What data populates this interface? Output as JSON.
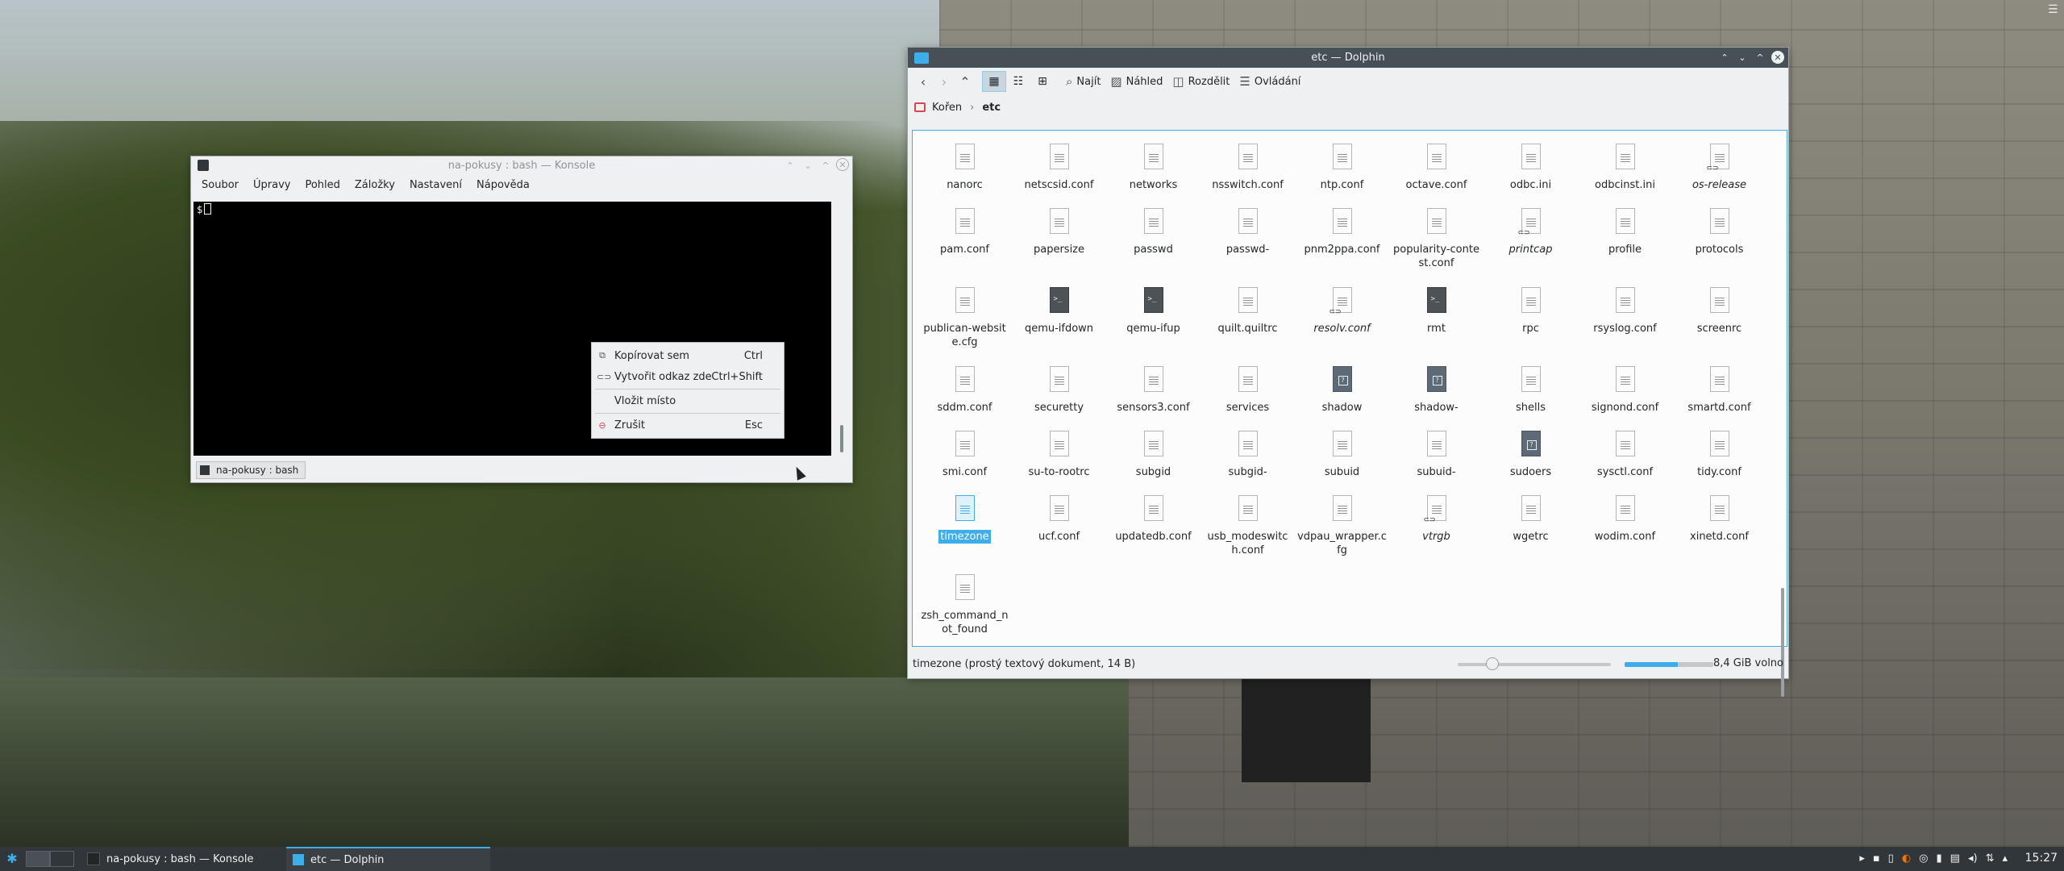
{
  "konsole": {
    "title": "na-pokusy : bash — Konsole",
    "menu": [
      "Soubor",
      "Úpravy",
      "Pohled",
      "Záložky",
      "Nastavení",
      "Nápověda"
    ],
    "prompt": "$",
    "tab_label": "na-pokusy : bash"
  },
  "context_menu": {
    "items": [
      {
        "label": "Kopírovat sem",
        "shortcut": "Ctrl",
        "icon": "copy-icon"
      },
      {
        "label": "Vytvořit odkaz zde",
        "shortcut": "Ctrl+Shift",
        "icon": "link-icon"
      },
      {
        "label": "Vložit místo",
        "shortcut": "",
        "icon": ""
      },
      {
        "label": "Zrušit",
        "shortcut": "Esc",
        "icon": "cancel-icon"
      }
    ]
  },
  "dolphin": {
    "title": "etc — Dolphin",
    "toolbar": {
      "find": "Najít",
      "preview": "Náhled",
      "split": "Rozdělit",
      "control": "Ovládání"
    },
    "breadcrumb": {
      "root": "Kořen",
      "current": "etc"
    },
    "files": [
      {
        "name": "nanorc",
        "type": "text"
      },
      {
        "name": "netscsid.conf",
        "type": "text"
      },
      {
        "name": "networks",
        "type": "text"
      },
      {
        "name": "nsswitch.conf",
        "type": "text"
      },
      {
        "name": "ntp.conf",
        "type": "text"
      },
      {
        "name": "octave.conf",
        "type": "text"
      },
      {
        "name": "odbc.ini",
        "type": "text"
      },
      {
        "name": "odbcinst.ini",
        "type": "text"
      },
      {
        "name": "os-release",
        "type": "link"
      },
      {
        "name": "pam.conf",
        "type": "text"
      },
      {
        "name": "papersize",
        "type": "text"
      },
      {
        "name": "passwd",
        "type": "text"
      },
      {
        "name": "passwd-",
        "type": "text"
      },
      {
        "name": "pnm2ppa.conf",
        "type": "text"
      },
      {
        "name": "popularity-contest.conf",
        "type": "text"
      },
      {
        "name": "printcap",
        "type": "link"
      },
      {
        "name": "profile",
        "type": "text"
      },
      {
        "name": "protocols",
        "type": "text"
      },
      {
        "name": "publican-website.cfg",
        "type": "text"
      },
      {
        "name": "qemu-ifdown",
        "type": "script"
      },
      {
        "name": "qemu-ifup",
        "type": "script"
      },
      {
        "name": "quilt.quiltrc",
        "type": "text"
      },
      {
        "name": "resolv.conf",
        "type": "link"
      },
      {
        "name": "rmt",
        "type": "script"
      },
      {
        "name": "rpc",
        "type": "text"
      },
      {
        "name": "rsyslog.conf",
        "type": "text"
      },
      {
        "name": "screenrc",
        "type": "text"
      },
      {
        "name": "sddm.conf",
        "type": "text"
      },
      {
        "name": "securetty",
        "type": "text"
      },
      {
        "name": "sensors3.conf",
        "type": "text"
      },
      {
        "name": "services",
        "type": "text"
      },
      {
        "name": "shadow",
        "type": "locked"
      },
      {
        "name": "shadow-",
        "type": "locked"
      },
      {
        "name": "shells",
        "type": "text"
      },
      {
        "name": "signond.conf",
        "type": "text"
      },
      {
        "name": "smartd.conf",
        "type": "text"
      },
      {
        "name": "smi.conf",
        "type": "text"
      },
      {
        "name": "su-to-rootrc",
        "type": "text"
      },
      {
        "name": "subgid",
        "type": "text"
      },
      {
        "name": "subgid-",
        "type": "text"
      },
      {
        "name": "subuid",
        "type": "text"
      },
      {
        "name": "subuid-",
        "type": "text"
      },
      {
        "name": "sudoers",
        "type": "locked"
      },
      {
        "name": "sysctl.conf",
        "type": "text"
      },
      {
        "name": "tidy.conf",
        "type": "text"
      },
      {
        "name": "timezone",
        "type": "selected"
      },
      {
        "name": "ucf.conf",
        "type": "text"
      },
      {
        "name": "updatedb.conf",
        "type": "text"
      },
      {
        "name": "usb_modeswitch.conf",
        "type": "text"
      },
      {
        "name": "vdpau_wrapper.cfg",
        "type": "text"
      },
      {
        "name": "vtrgb",
        "type": "link"
      },
      {
        "name": "wgetrc",
        "type": "text"
      },
      {
        "name": "wodim.conf",
        "type": "text"
      },
      {
        "name": "xinetd.conf",
        "type": "text"
      },
      {
        "name": "zsh_command_not_found",
        "type": "text"
      }
    ],
    "status": {
      "selection": "timezone (prostý textový dokument, 14 B)",
      "free_space": "8,4 GiB volno",
      "used_fraction": 0.6,
      "zoom_fraction": 0.2
    }
  },
  "taskbar": {
    "tasks": [
      {
        "label": "na-pokusy : bash — Konsole"
      },
      {
        "label": "etc — Dolphin"
      }
    ],
    "clock": "15:27"
  },
  "colors": {
    "accent": "#3daee9",
    "titlebar_active": "#475057",
    "panel": "#31363b"
  }
}
